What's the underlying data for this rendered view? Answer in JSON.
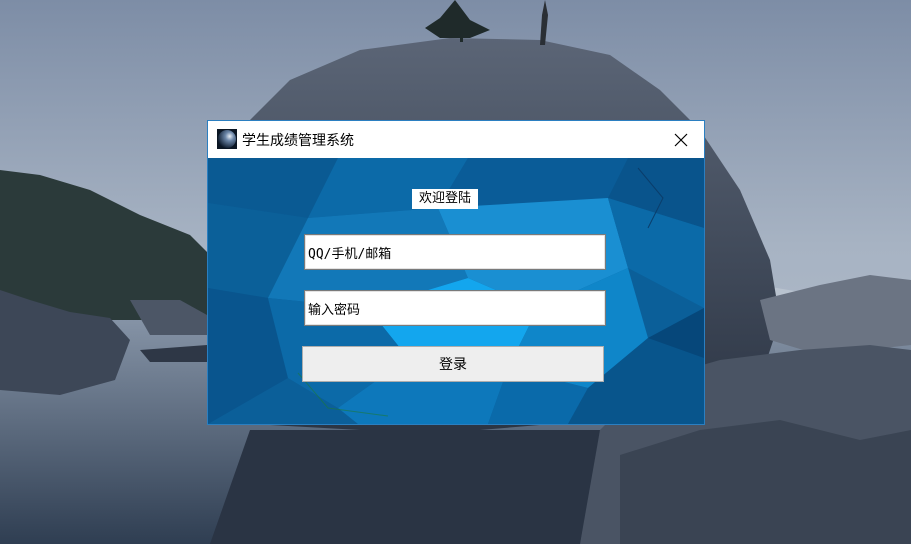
{
  "window": {
    "title": "学生成绩管理系统",
    "icon": "app-sphere-icon",
    "close_icon": "close-icon"
  },
  "login": {
    "welcome_label": "欢迎登陆",
    "username_value": "QQ/手机/邮箱",
    "password_value": "输入密码",
    "login_button_label": "登录"
  },
  "colors": {
    "window_border": "#2b7fc1",
    "panel_background": "#0a5f9a",
    "button_background": "#eeeeee"
  }
}
